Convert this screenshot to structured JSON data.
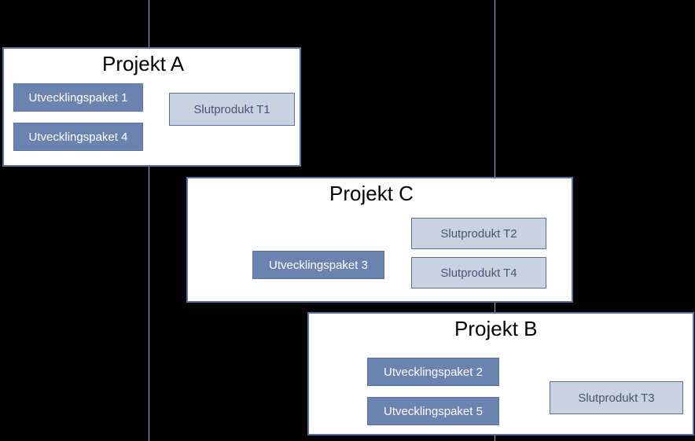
{
  "projects": {
    "A": {
      "title": "Projekt A",
      "packages": [
        "Utvecklingspaket 1",
        "Utvecklingspaket 4"
      ],
      "products": [
        "Slutprodukt T1"
      ]
    },
    "C": {
      "title": "Projekt C",
      "packages": [
        "Utvecklingspaket 3"
      ],
      "products": [
        "Slutprodukt T2",
        "Slutprodukt T4"
      ]
    },
    "B": {
      "title": "Projekt B",
      "packages": [
        "Utvecklingspaket 2",
        "Utvecklingspaket 5"
      ],
      "products": [
        "Slutprodukt T3"
      ]
    }
  }
}
